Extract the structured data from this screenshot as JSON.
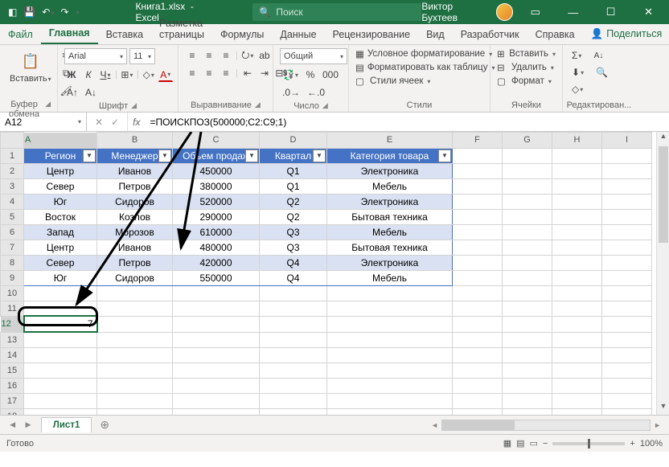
{
  "titlebar": {
    "filename": "Книга1.xlsx",
    "app": "Excel",
    "search_placeholder": "Поиск",
    "username": "Виктор Бухтеев"
  },
  "tabs": {
    "file": "Файл",
    "items": [
      "Главная",
      "Вставка",
      "Разметка страницы",
      "Формулы",
      "Данные",
      "Рецензирование",
      "Вид",
      "Разработчик",
      "Справка"
    ],
    "share": "Поделиться"
  },
  "ribbon": {
    "clipboard": {
      "paste": "Вставить",
      "label": "Буфер обмена"
    },
    "font": {
      "name": "Arial",
      "size": "11",
      "label": "Шрифт"
    },
    "align": {
      "label": "Выравнивание"
    },
    "number": {
      "format": "Общий",
      "label": "Число"
    },
    "styles": {
      "cond": "Условное форматирование",
      "table": "Форматировать как таблицу",
      "cell": "Стили ячеек",
      "label": "Стили"
    },
    "cells": {
      "insert": "Вставить",
      "delete": "Удалить",
      "format": "Формат",
      "label": "Ячейки"
    },
    "editing": {
      "label": "Редактирован..."
    }
  },
  "formula": {
    "cell_ref": "A12",
    "fx": "fx",
    "value": "=ПОИСКПОЗ(500000;C2:C9;1)"
  },
  "columns": [
    "A",
    "B",
    "C",
    "D",
    "E",
    "F",
    "G",
    "H",
    "I"
  ],
  "headers": [
    "Регион",
    "Менеджер",
    "Объем продаж",
    "Квартал",
    "Категория товара"
  ],
  "rows": [
    [
      "Центр",
      "Иванов",
      "450000",
      "Q1",
      "Электроника"
    ],
    [
      "Север",
      "Петров",
      "380000",
      "Q1",
      "Мебель"
    ],
    [
      "Юг",
      "Сидоров",
      "520000",
      "Q2",
      "Электроника"
    ],
    [
      "Восток",
      "Козлов",
      "290000",
      "Q2",
      "Бытовая техника"
    ],
    [
      "Запад",
      "Морозов",
      "610000",
      "Q3",
      "Мебель"
    ],
    [
      "Центр",
      "Иванов",
      "480000",
      "Q3",
      "Бытовая техника"
    ],
    [
      "Север",
      "Петров",
      "420000",
      "Q4",
      "Электроника"
    ],
    [
      "Юг",
      "Сидоров",
      "550000",
      "Q4",
      "Мебель"
    ]
  ],
  "result_cell": "7",
  "sheet": {
    "name": "Лист1"
  },
  "status": {
    "ready": "Готово",
    "zoom": "100%"
  }
}
